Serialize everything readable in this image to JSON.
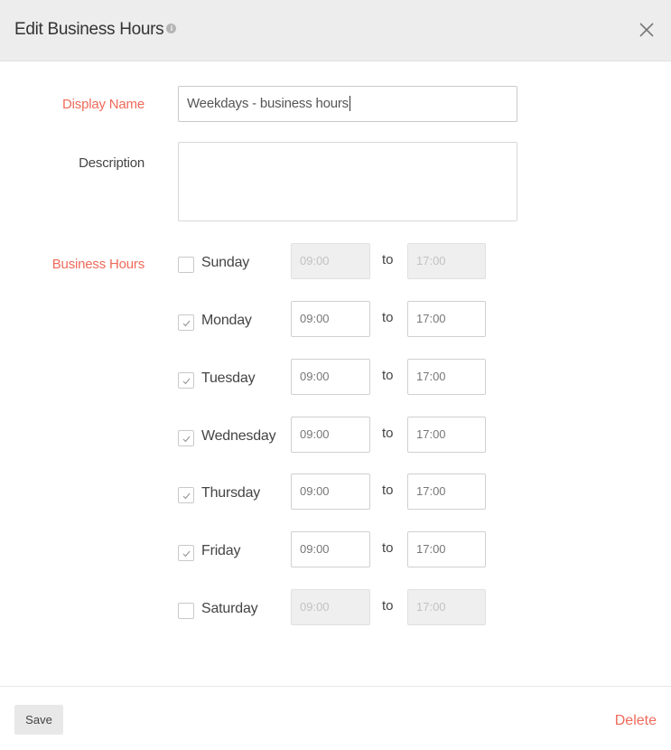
{
  "dialog": {
    "title": "Edit Business Hours",
    "info_icon": "info-icon",
    "close_icon": "close-icon"
  },
  "form": {
    "display_name": {
      "label": "Display Name",
      "value": "Weekdays - business hours",
      "required": true
    },
    "description": {
      "label": "Description",
      "value": ""
    },
    "business_hours": {
      "label": "Business Hours",
      "separator": "to",
      "days": [
        {
          "name": "Sunday",
          "checked": false,
          "from": "09:00",
          "to": "17:00"
        },
        {
          "name": "Monday",
          "checked": true,
          "from": "09:00",
          "to": "17:00"
        },
        {
          "name": "Tuesday",
          "checked": true,
          "from": "09:00",
          "to": "17:00"
        },
        {
          "name": "Wednesday",
          "checked": true,
          "from": "09:00",
          "to": "17:00"
        },
        {
          "name": "Thursday",
          "checked": true,
          "from": "09:00",
          "to": "17:00"
        },
        {
          "name": "Friday",
          "checked": true,
          "from": "09:00",
          "to": "17:00"
        },
        {
          "name": "Saturday",
          "checked": false,
          "from": "09:00",
          "to": "17:00"
        }
      ]
    }
  },
  "footer": {
    "save_label": "Save",
    "delete_label": "Delete"
  },
  "colors": {
    "accent": "#ef6a5a",
    "header_bg": "#ededed"
  }
}
